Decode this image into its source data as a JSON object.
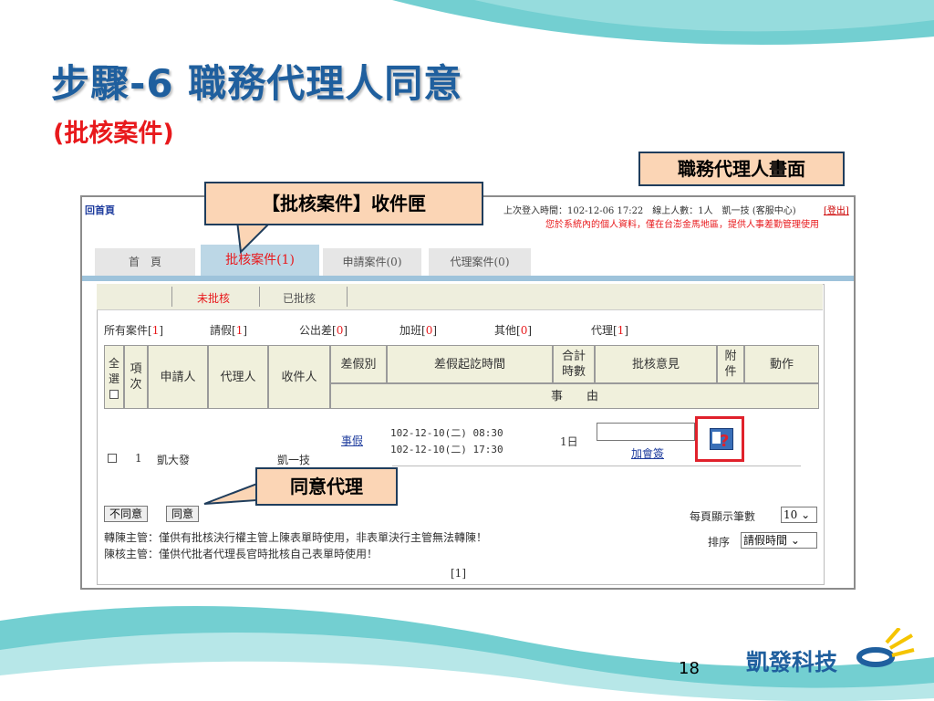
{
  "slide": {
    "title": "步驟-6  職務代理人同意",
    "subtitle": "(批核案件)",
    "screen_label": "職務代理人畫面",
    "inbox_callout": "【批核案件】收件匣",
    "approve_callout": "同意代理",
    "page_number": "18",
    "brand_name": "凱發科技",
    "colors": {
      "title": "#1f5f9e",
      "subtitle": "#e8191c",
      "callout_fill": "#fbd5b5",
      "wave": "#5bc7c9"
    }
  },
  "app": {
    "home_link": "回首頁",
    "login_info": "上次登入時間：102-12-06 17:22　線上人數：1人　凱一技 (客服中心)",
    "logout_link": "[登出]",
    "notice": "您於系統內的個人資料，僅在台澎金馬地區，提供人事差勤管理使用",
    "tabs": [
      "首　頁",
      "批核案件(1)",
      "申請案件(0)",
      "代理案件(0)"
    ],
    "subtabs": [
      "未批核",
      "已批核"
    ],
    "filters": [
      {
        "label": "所有案件",
        "count": "1"
      },
      {
        "label": "請假",
        "count": "1"
      },
      {
        "label": "公出差",
        "count": "0"
      },
      {
        "label": "加班",
        "count": "0"
      },
      {
        "label": "其他",
        "count": "0"
      },
      {
        "label": "代理",
        "count": "1"
      }
    ],
    "table": {
      "headers": {
        "select_all": "全選",
        "seq": "項次",
        "applicant": "申請人",
        "agent": "代理人",
        "recipient": "收件人",
        "leave_type": "差假別",
        "period": "差假起訖時間",
        "total": "合計時數",
        "comment": "批核意見",
        "attachment": "附件",
        "action": "動作",
        "reason": "事　　由"
      },
      "row": {
        "seq": "1",
        "applicant": "凱大發",
        "recipient": "凱一技",
        "leave_type": "事假",
        "start": "102-12-10(二) 08:30",
        "end": "102-12-10(二) 17:30",
        "total": "1日",
        "add_sign": "加會簽"
      }
    },
    "buttons": {
      "reject": "不同意",
      "approve": "同意"
    },
    "per_page_label": "每頁顯示筆數",
    "per_page_value": "10",
    "sort_label": "排序",
    "sort_value": "請假時間",
    "notes": [
      "轉陳主管：僅供有批核決行權主管上陳表單時使用，非表單決行主管無法轉陳！",
      "陳核主管：僅供代批者代理長官時批核自己表單時使用！"
    ],
    "pagination": "[1]"
  }
}
